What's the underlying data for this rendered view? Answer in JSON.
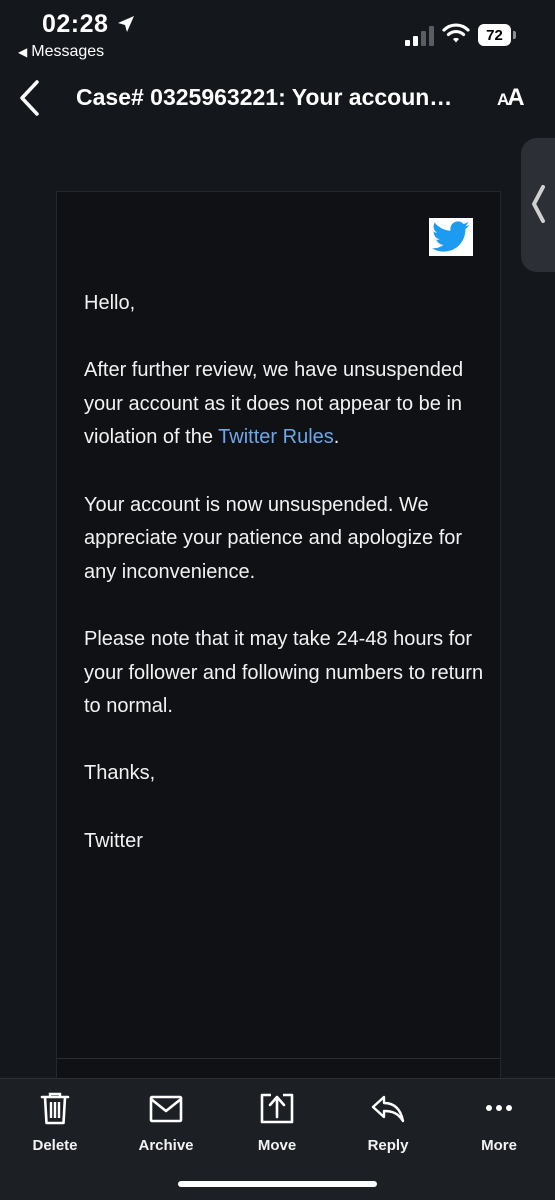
{
  "status_bar": {
    "time": "02:28",
    "back_app": "Messages",
    "battery": "72",
    "icons": [
      "location-arrow-icon",
      "cellular-signal-icon",
      "wifi-icon",
      "battery-icon"
    ]
  },
  "header": {
    "back_icon": "chevron-left-icon",
    "subject": "Case# 0325963221: Your accoun…",
    "text_size_label": "AA"
  },
  "email": {
    "logo": "twitter-bird-icon",
    "greeting": "Hello,",
    "paragraph1_before_link": "After further review, we have unsuspended your account as it does not appear to be in violation of the ",
    "paragraph1_link": "Twitter Rules",
    "paragraph1_after_link": ".",
    "paragraph2": "Your account is now unsuspended. We appreciate your patience and apologize for any inconvenience.",
    "paragraph3": "Please note that it may take 24-48 hours for your follower and following numbers to return to normal.",
    "signoff": "Thanks,",
    "signature": "Twitter",
    "link_color": "#6ea6e6"
  },
  "toolbar": {
    "items": [
      {
        "label": "Delete",
        "icon": "trash-icon"
      },
      {
        "label": "Archive",
        "icon": "archive-icon"
      },
      {
        "label": "Move",
        "icon": "move-icon"
      },
      {
        "label": "Reply",
        "icon": "reply-icon"
      },
      {
        "label": "More",
        "icon": "more-icon"
      }
    ]
  },
  "colors": {
    "background": "#14171c",
    "card": "#0f1115",
    "toolbar": "#1c1f24",
    "twitter_blue": "#1d9bf0"
  }
}
